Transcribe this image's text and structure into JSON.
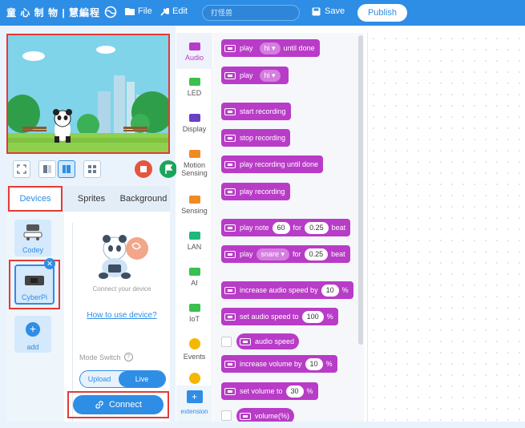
{
  "topbar": {
    "logo": "童 心 制 物 | 慧編程",
    "file": "File",
    "edit": "Edit",
    "project_name": "打怪兽",
    "save": "Save",
    "publish": "Publish"
  },
  "left_panel": {
    "tabs": [
      "Devices",
      "Sprites",
      "Background"
    ],
    "devices": [
      {
        "label": "Codey"
      },
      {
        "label": "CyberPi"
      }
    ],
    "add_label": "add",
    "connect_text": "Connect your device",
    "howto_link": "How to use device?",
    "mode_switch_label": "Mode Switch",
    "mode_upload": "Upload",
    "mode_live": "Live",
    "connect_button": "Connect"
  },
  "categories": [
    {
      "label": "Audio",
      "color": "#b83cc7"
    },
    {
      "label": "LED",
      "color": "#3bbf4e"
    },
    {
      "label": "Display",
      "color": "#6a3fc2"
    },
    {
      "label": "Motion Sensing",
      "color": "#f08a24"
    },
    {
      "label": "Sensing",
      "color": "#f08a24"
    },
    {
      "label": "LAN",
      "color": "#20b87a"
    },
    {
      "label": "AI",
      "color": "#3bbf4e"
    },
    {
      "label": "IoT",
      "color": "#3bbf4e"
    },
    {
      "label": "Events",
      "color": "#f5b700"
    }
  ],
  "extension_label": "extension",
  "blocks": {
    "play_until_done": {
      "a": "play",
      "dd": "hi ▾",
      "b": "until done"
    },
    "play": {
      "a": "play",
      "dd": "hi ▾"
    },
    "start_recording": "start recording",
    "stop_recording": "stop recording",
    "play_recording_until_done": "play recording until done",
    "play_recording": "play recording",
    "play_note": {
      "a": "play note",
      "v1": "60",
      "b": "for",
      "v2": "0.25",
      "c": "beat"
    },
    "play_drum": {
      "a": "play",
      "dd": "snare ▾",
      "b": "for",
      "v": "0.25",
      "c": "beat"
    },
    "increase_speed": {
      "a": "increase audio speed by",
      "v": "10",
      "b": "%"
    },
    "set_speed": {
      "a": "set audio speed to",
      "v": "100",
      "b": "%"
    },
    "audio_speed": "audio speed",
    "increase_volume": {
      "a": "increase volume by",
      "v": "10",
      "b": "%"
    },
    "set_volume": {
      "a": "set volume to",
      "v": "30",
      "b": "%"
    },
    "volume": "volume(%)"
  }
}
